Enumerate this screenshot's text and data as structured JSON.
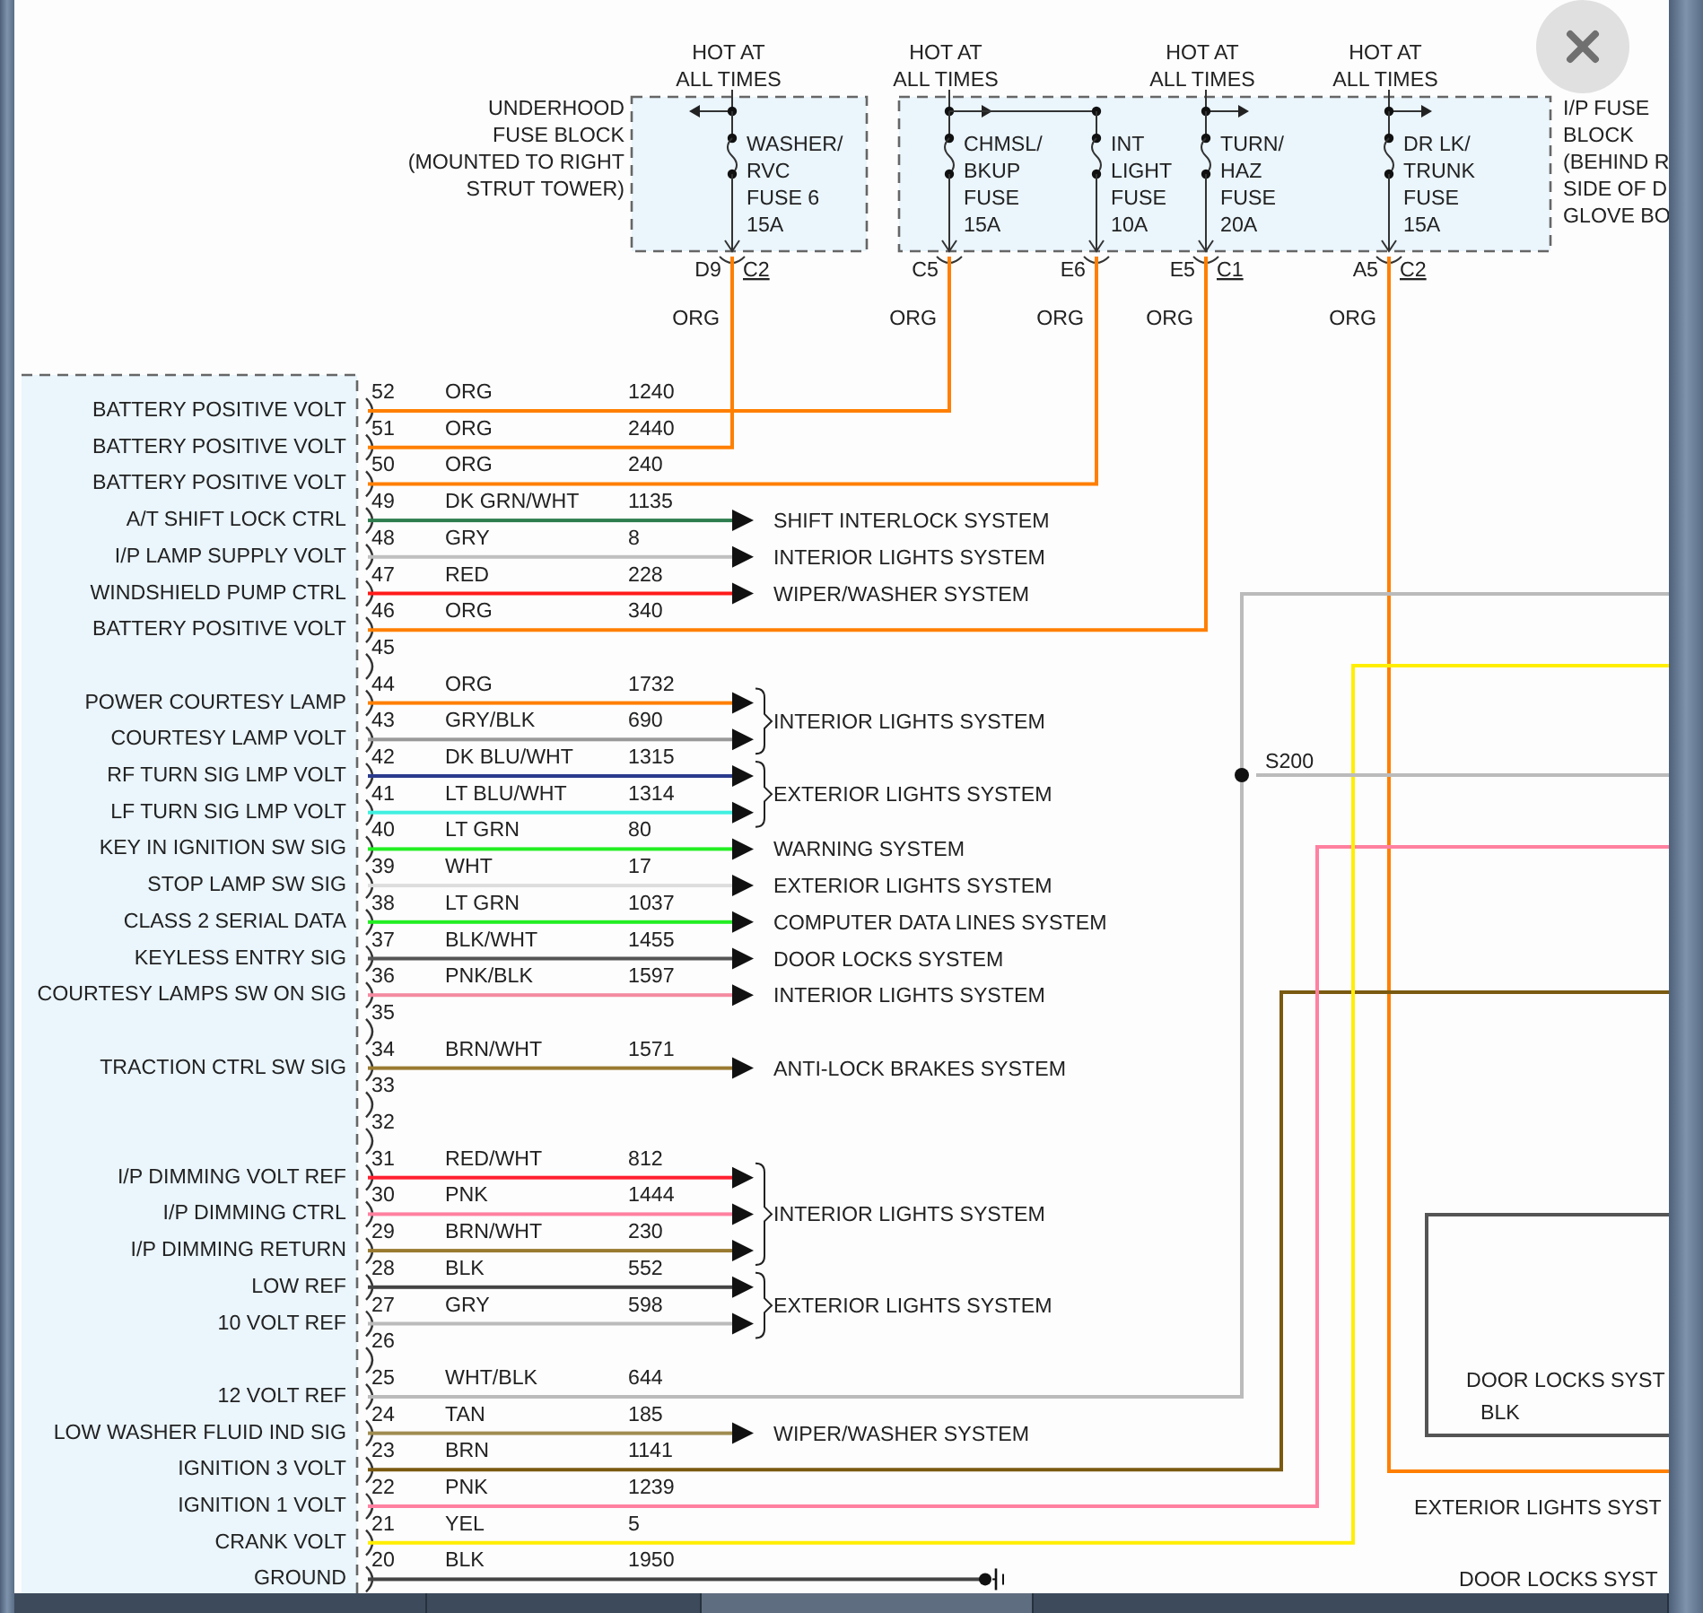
{
  "fuse_blocks": [
    {
      "label": [
        "UNDERHOOD",
        "FUSE BLOCK",
        "(MOUNTED TO RIGHT",
        "STRUT TOWER)"
      ],
      "fuses": [
        {
          "hot": [
            "HOT AT",
            "ALL TIMES"
          ],
          "name": [
            "WASHER/",
            "RVC",
            "FUSE 6",
            "15A"
          ],
          "left_pin": "D9",
          "right_pin": "C2",
          "wire": "ORG"
        }
      ]
    },
    {
      "label": [
        "I/P FUSE",
        "BLOCK",
        "(BEHIND R",
        "SIDE OF D",
        "GLOVE BO"
      ],
      "fuses": [
        {
          "hot": [
            "HOT AT",
            "ALL TIMES"
          ],
          "name": [
            "CHMSL/",
            "BKUP",
            "FUSE",
            "15A"
          ],
          "left_pin": "C5",
          "wire": "ORG"
        },
        {
          "name": [
            "INT",
            "LIGHT",
            "FUSE",
            "10A"
          ],
          "left_pin": "E6",
          "wire": "ORG"
        },
        {
          "hot": [
            "HOT AT",
            "ALL TIMES"
          ],
          "name": [
            "TURN/",
            "HAZ",
            "FUSE",
            "20A"
          ],
          "left_pin": "E5",
          "right_pin": "C1",
          "wire": "ORG"
        },
        {
          "hot": [
            "HOT AT",
            "ALL TIMES"
          ],
          "name": [
            "DR LK/",
            "TRUNK",
            "FUSE",
            "15A"
          ],
          "left_pin": "A5",
          "right_pin": "C2",
          "wire": "ORG"
        }
      ]
    }
  ],
  "connector": {
    "rows": [
      {
        "kind": "route",
        "number": "52",
        "name": "BATTERY POSITIVE VOLT",
        "color_code": "ORG",
        "circuit": "1240",
        "color": "#ff7f00"
      },
      {
        "kind": "route",
        "number": "51",
        "name": "BATTERY POSITIVE VOLT",
        "color_code": "ORG",
        "circuit": "2440",
        "color": "#ff7f00"
      },
      {
        "kind": "route",
        "number": "50",
        "name": "BATTERY POSITIVE VOLT",
        "color_code": "ORG",
        "circuit": "240",
        "color": "#ff7f00"
      },
      {
        "kind": "arrow",
        "number": "49",
        "name": "A/T SHIFT LOCK CTRL",
        "color_code": "DK GRN/WHT",
        "circuit": "1135",
        "color": "#2e7d4f",
        "system": "SHIFT INTERLOCK SYSTEM"
      },
      {
        "kind": "arrow",
        "number": "48",
        "name": "I/P LAMP SUPPLY VOLT",
        "color_code": "GRY",
        "circuit": "8",
        "color": "#c0c0c0",
        "system": "INTERIOR LIGHTS SYSTEM"
      },
      {
        "kind": "arrow",
        "number": "47",
        "name": "WINDSHIELD PUMP CTRL",
        "color_code": "RED",
        "circuit": "228",
        "color": "#ff1a1a",
        "system": "WIPER/WASHER SYSTEM"
      },
      {
        "kind": "route",
        "number": "46",
        "name": "BATTERY POSITIVE VOLT",
        "color_code": "ORG",
        "circuit": "340",
        "color": "#ff7f00"
      },
      {
        "kind": "empty",
        "number": "45"
      },
      {
        "kind": "bundle",
        "system": "INTERIOR LIGHTS SYSTEM",
        "pins": [
          {
            "kind": "arrow",
            "number": "44",
            "name": "POWER COURTESY LAMP",
            "color_code": "ORG",
            "circuit": "1732",
            "color": "#ff7f00"
          },
          {
            "kind": "arrow",
            "number": "43",
            "name": "COURTESY LAMP VOLT",
            "color_code": "GRY/BLK",
            "circuit": "690",
            "color": "#999999"
          }
        ]
      },
      {
        "kind": "bundle",
        "system": "EXTERIOR LIGHTS SYSTEM",
        "pins": [
          {
            "kind": "arrow",
            "number": "42",
            "name": "RF TURN SIG LMP VOLT",
            "color_code": "DK BLU/WHT",
            "circuit": "1315",
            "color": "#2b3a8c"
          },
          {
            "kind": "arrow",
            "number": "41",
            "name": "LF TURN SIG LMP VOLT",
            "color_code": "LT BLU/WHT",
            "circuit": "1314",
            "color": "#40f0e0"
          }
        ]
      },
      {
        "kind": "arrow",
        "number": "40",
        "name": "KEY IN IGNITION SW SIG",
        "color_code": "LT GRN",
        "circuit": "80",
        "color": "#22ee22",
        "system": "WARNING SYSTEM"
      },
      {
        "kind": "arrow",
        "number": "39",
        "name": "STOP LAMP SW SIG",
        "color_code": "WHT",
        "circuit": "17",
        "color": "#dddddd",
        "system": "EXTERIOR LIGHTS SYSTEM"
      },
      {
        "kind": "arrow",
        "number": "38",
        "name": "CLASS 2 SERIAL DATA",
        "color_code": "LT GRN",
        "circuit": "1037",
        "color": "#22ee22",
        "system": "COMPUTER DATA LINES SYSTEM"
      },
      {
        "kind": "arrow",
        "number": "37",
        "name": "KEYLESS ENTRY SIG",
        "color_code": "BLK/WHT",
        "circuit": "1455",
        "color": "#555555",
        "system": "DOOR LOCKS SYSTEM"
      },
      {
        "kind": "arrow",
        "number": "36",
        "name": "COURTESY LAMPS SW ON SIG",
        "color_code": "PNK/BLK",
        "circuit": "1597",
        "color": "#f48aa0",
        "system": "INTERIOR LIGHTS SYSTEM"
      },
      {
        "kind": "empty",
        "number": "35"
      },
      {
        "kind": "arrow",
        "number": "34",
        "name": "TRACTION CTRL SW SIG",
        "color_code": "BRN/WHT",
        "circuit": "1571",
        "color": "#9a7a30",
        "system": "ANTI-LOCK BRAKES SYSTEM"
      },
      {
        "kind": "empty",
        "number": "33"
      },
      {
        "kind": "empty",
        "number": "32"
      },
      {
        "kind": "bundle",
        "system": "INTERIOR LIGHTS SYSTEM",
        "pins": [
          {
            "kind": "arrow",
            "number": "31",
            "name": "I/P DIMMING VOLT REF",
            "color_code": "RED/WHT",
            "circuit": "812",
            "color": "#ff2030"
          },
          {
            "kind": "arrow",
            "number": "30",
            "name": "I/P DIMMING CTRL",
            "color_code": "PNK",
            "circuit": "1444",
            "color": "#ff80a0"
          },
          {
            "kind": "arrow",
            "number": "29",
            "name": "I/P DIMMING RETURN",
            "color_code": "BRN/WHT",
            "circuit": "230",
            "color": "#9a7a30"
          }
        ]
      },
      {
        "kind": "bundle",
        "system": "EXTERIOR LIGHTS SYSTEM",
        "pins": [
          {
            "kind": "arrow",
            "number": "28",
            "name": "LOW REF",
            "color_code": "BLK",
            "circuit": "552",
            "color": "#444444"
          },
          {
            "kind": "arrow",
            "number": "27",
            "name": "10 VOLT REF",
            "color_code": "GRY",
            "circuit": "598",
            "color": "#bbbbbb"
          }
        ]
      },
      {
        "kind": "empty",
        "number": "26"
      },
      {
        "kind": "route",
        "number": "25",
        "name": "12 VOLT REF",
        "color_code": "WHT/BLK",
        "circuit": "644",
        "color": "#bbbbbb"
      },
      {
        "kind": "arrow",
        "number": "24",
        "name": "LOW WASHER FLUID IND SIG",
        "color_code": "TAN",
        "circuit": "185",
        "color": "#a08c50",
        "system": "WIPER/WASHER SYSTEM"
      },
      {
        "kind": "route",
        "number": "23",
        "name": "IGNITION 3 VOLT",
        "color_code": "BRN",
        "circuit": "1141",
        "color": "#7a5a10"
      },
      {
        "kind": "route",
        "number": "22",
        "name": "IGNITION 1 VOLT",
        "color_code": "PNK",
        "circuit": "1239",
        "color": "#ff80a0"
      },
      {
        "kind": "route",
        "number": "21",
        "name": "CRANK VOLT",
        "color_code": "YEL",
        "circuit": "5",
        "color": "#ffee00"
      },
      {
        "kind": "ground",
        "number": "20",
        "name": "GROUND",
        "color_code": "BLK",
        "circuit": "1950",
        "color": "#444444"
      }
    ]
  },
  "splice": {
    "label": "S200"
  },
  "component": {
    "system": "DOOR LOCKS SYST",
    "color_code": "BLK"
  },
  "offpage_labels": [
    "EXTERIOR LIGHTS SYST",
    "DOOR LOCKS SYST"
  ]
}
